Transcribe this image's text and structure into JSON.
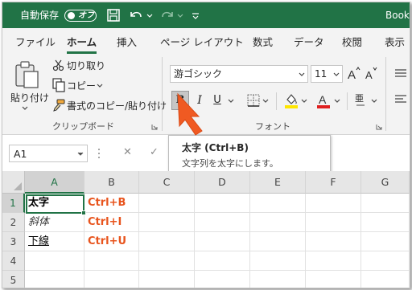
{
  "title_bar": {
    "autosave_label": "自動保存",
    "autosave_state": "オフ",
    "workbook_name": "Book",
    "icons": [
      "save-icon",
      "undo-icon",
      "redo-icon",
      "customize-quick-access-icon"
    ],
    "color": "#217346"
  },
  "tabs": [
    {
      "label": "ファイル"
    },
    {
      "label": "ホーム",
      "active": true
    },
    {
      "label": "挿入"
    },
    {
      "label": "ページ レイアウト"
    },
    {
      "label": "数式"
    },
    {
      "label": "データ"
    },
    {
      "label": "校閲"
    },
    {
      "label": "表示"
    }
  ],
  "clipboard": {
    "paste_label": "貼り付け",
    "cut_label": "切り取り",
    "copy_label": "コピー",
    "format_painter_label": "書式のコピー/貼り付け",
    "group_label": "クリップボード"
  },
  "font": {
    "font_name": "游ゴシック",
    "font_size": "11",
    "bold_label": "B",
    "italic_label": "I",
    "underline_label": "U",
    "phonetic_label": "亜",
    "group_label": "フォント",
    "font_color": "#e02020",
    "highlight_color": "#ffe600"
  },
  "tooltip": {
    "title": "太字 (Ctrl+B)",
    "description": "文字列を太字にします。"
  },
  "formula_bar": {
    "name_box": "A1",
    "cancel_symbol": "✕",
    "enter_symbol": "✓"
  },
  "grid": {
    "columns": [
      "A",
      "B",
      "C",
      "D",
      "E",
      "F",
      "G"
    ],
    "rows": [
      "1",
      "2",
      "3",
      "4",
      "5"
    ],
    "cells": {
      "a1": "太字",
      "b1": "Ctrl+B",
      "a2": "斜体",
      "b2": "Ctrl+I",
      "a3": "下線",
      "b3": "Ctrl+U"
    },
    "shortcut_color": "#e8541d",
    "selected_cell": "A1"
  },
  "pointer_color": "#f05a22"
}
